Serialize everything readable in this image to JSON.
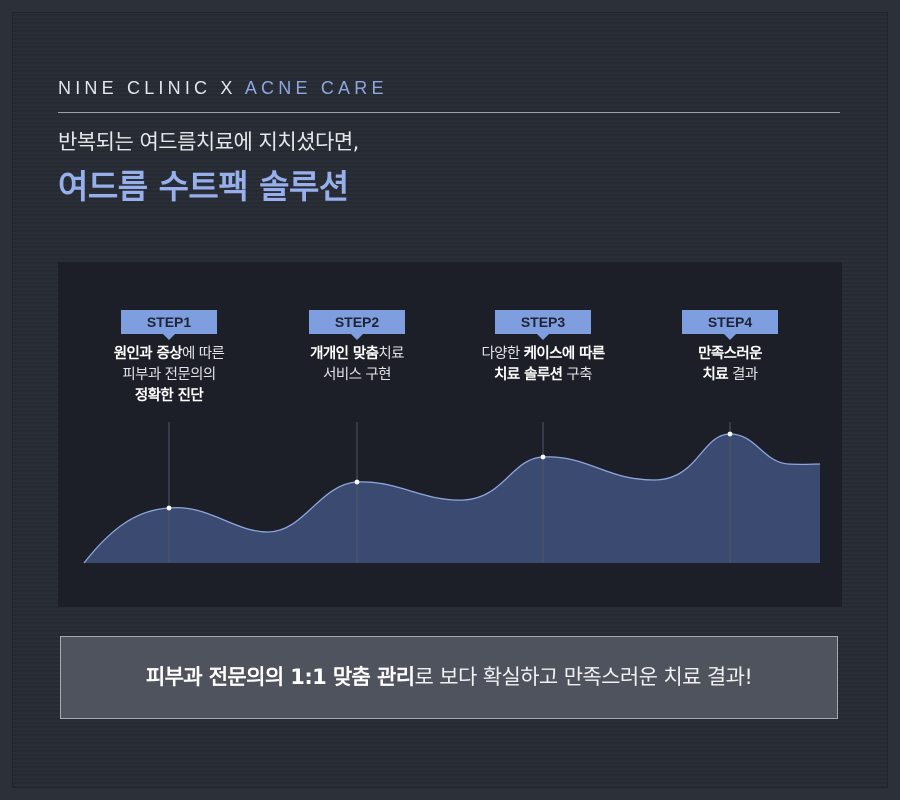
{
  "header": {
    "brand_main": "NINE CLINIC X",
    "brand_accent": "ACNE CARE",
    "subtitle": "반복되는 여드름치료에 지치셨다면,",
    "title": "여드름 수트팩 솔루션"
  },
  "steps": [
    {
      "label": "STEP1",
      "text": [
        [
          {
            "t": "원인과 증상",
            "b": true
          },
          {
            "t": "에 따른",
            "b": false
          }
        ],
        [
          {
            "t": "피부과 전문의의",
            "b": false
          }
        ],
        [
          {
            "t": "정확한 진단",
            "b": true
          }
        ]
      ]
    },
    {
      "label": "STEP2",
      "text": [
        [
          {
            "t": "개개인 맞춤",
            "b": true
          },
          {
            "t": "치료",
            "b": false
          }
        ],
        [
          {
            "t": "서비스 구현",
            "b": false
          }
        ]
      ]
    },
    {
      "label": "STEP3",
      "text": [
        [
          {
            "t": "다양한 ",
            "b": false
          },
          {
            "t": "케이스에 따른",
            "b": true
          }
        ],
        [
          {
            "t": "치료 솔루션",
            "b": true
          },
          {
            "t": " 구축",
            "b": false
          }
        ]
      ]
    },
    {
      "label": "STEP4",
      "text": [
        [
          {
            "t": "만족스러운",
            "b": true
          }
        ],
        [
          {
            "t": "치료",
            "b": true
          },
          {
            "t": " 결과",
            "b": false
          }
        ]
      ]
    }
  ],
  "banner": {
    "bold": "피부과 전문의의 1:1 맞춤 관리",
    "rest": "로 보다 확실하고 만족스러운 치료 결과!"
  },
  "colors": {
    "accent": "#97b0ec",
    "badge": "#7f9ee0",
    "wave_fill": "#3b4a70",
    "wave_line": "#8ea6de"
  }
}
